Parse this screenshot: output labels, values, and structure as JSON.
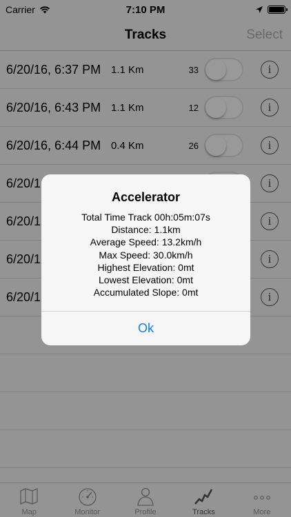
{
  "status_bar": {
    "carrier": "Carrier",
    "time": "7:10 PM"
  },
  "nav": {
    "title": "Tracks",
    "select_label": "Select"
  },
  "rows": [
    {
      "date": "6/20/16, 6:37 PM",
      "distance": "1.1 Km",
      "count": "33"
    },
    {
      "date": "6/20/16, 6:43 PM",
      "distance": "1.1 Km",
      "count": "12"
    },
    {
      "date": "6/20/16, 6:44 PM",
      "distance": "0.4 Km",
      "count": "26"
    },
    {
      "date": "6/20/1",
      "distance": "",
      "count": ""
    },
    {
      "date": "6/20/1",
      "distance": "",
      "count": ""
    },
    {
      "date": "6/20/1",
      "distance": "",
      "count": ""
    },
    {
      "date": "6/20/1",
      "distance": "",
      "count": ""
    }
  ],
  "tabs": [
    {
      "label": "Map",
      "icon": "map-icon"
    },
    {
      "label": "Monitor",
      "icon": "gauge-icon"
    },
    {
      "label": "Profile",
      "icon": "person-icon"
    },
    {
      "label": "Tracks",
      "icon": "track-icon"
    },
    {
      "label": "More",
      "icon": "more-icon"
    }
  ],
  "alert": {
    "title": "Accelerator",
    "lines": [
      "Total Time Track 00h:05m:07s",
      "Distance: 1.1km",
      "Average Speed: 13.2km/h",
      "Max Speed: 30.0km/h",
      "Highest Elevation: 0mt",
      "Lowest Elevation: 0mt",
      "Accumulated Slope: 0mt"
    ],
    "ok_label": "Ok"
  },
  "colors": {
    "accent": "#0a7aff",
    "overlay": "#000000"
  }
}
